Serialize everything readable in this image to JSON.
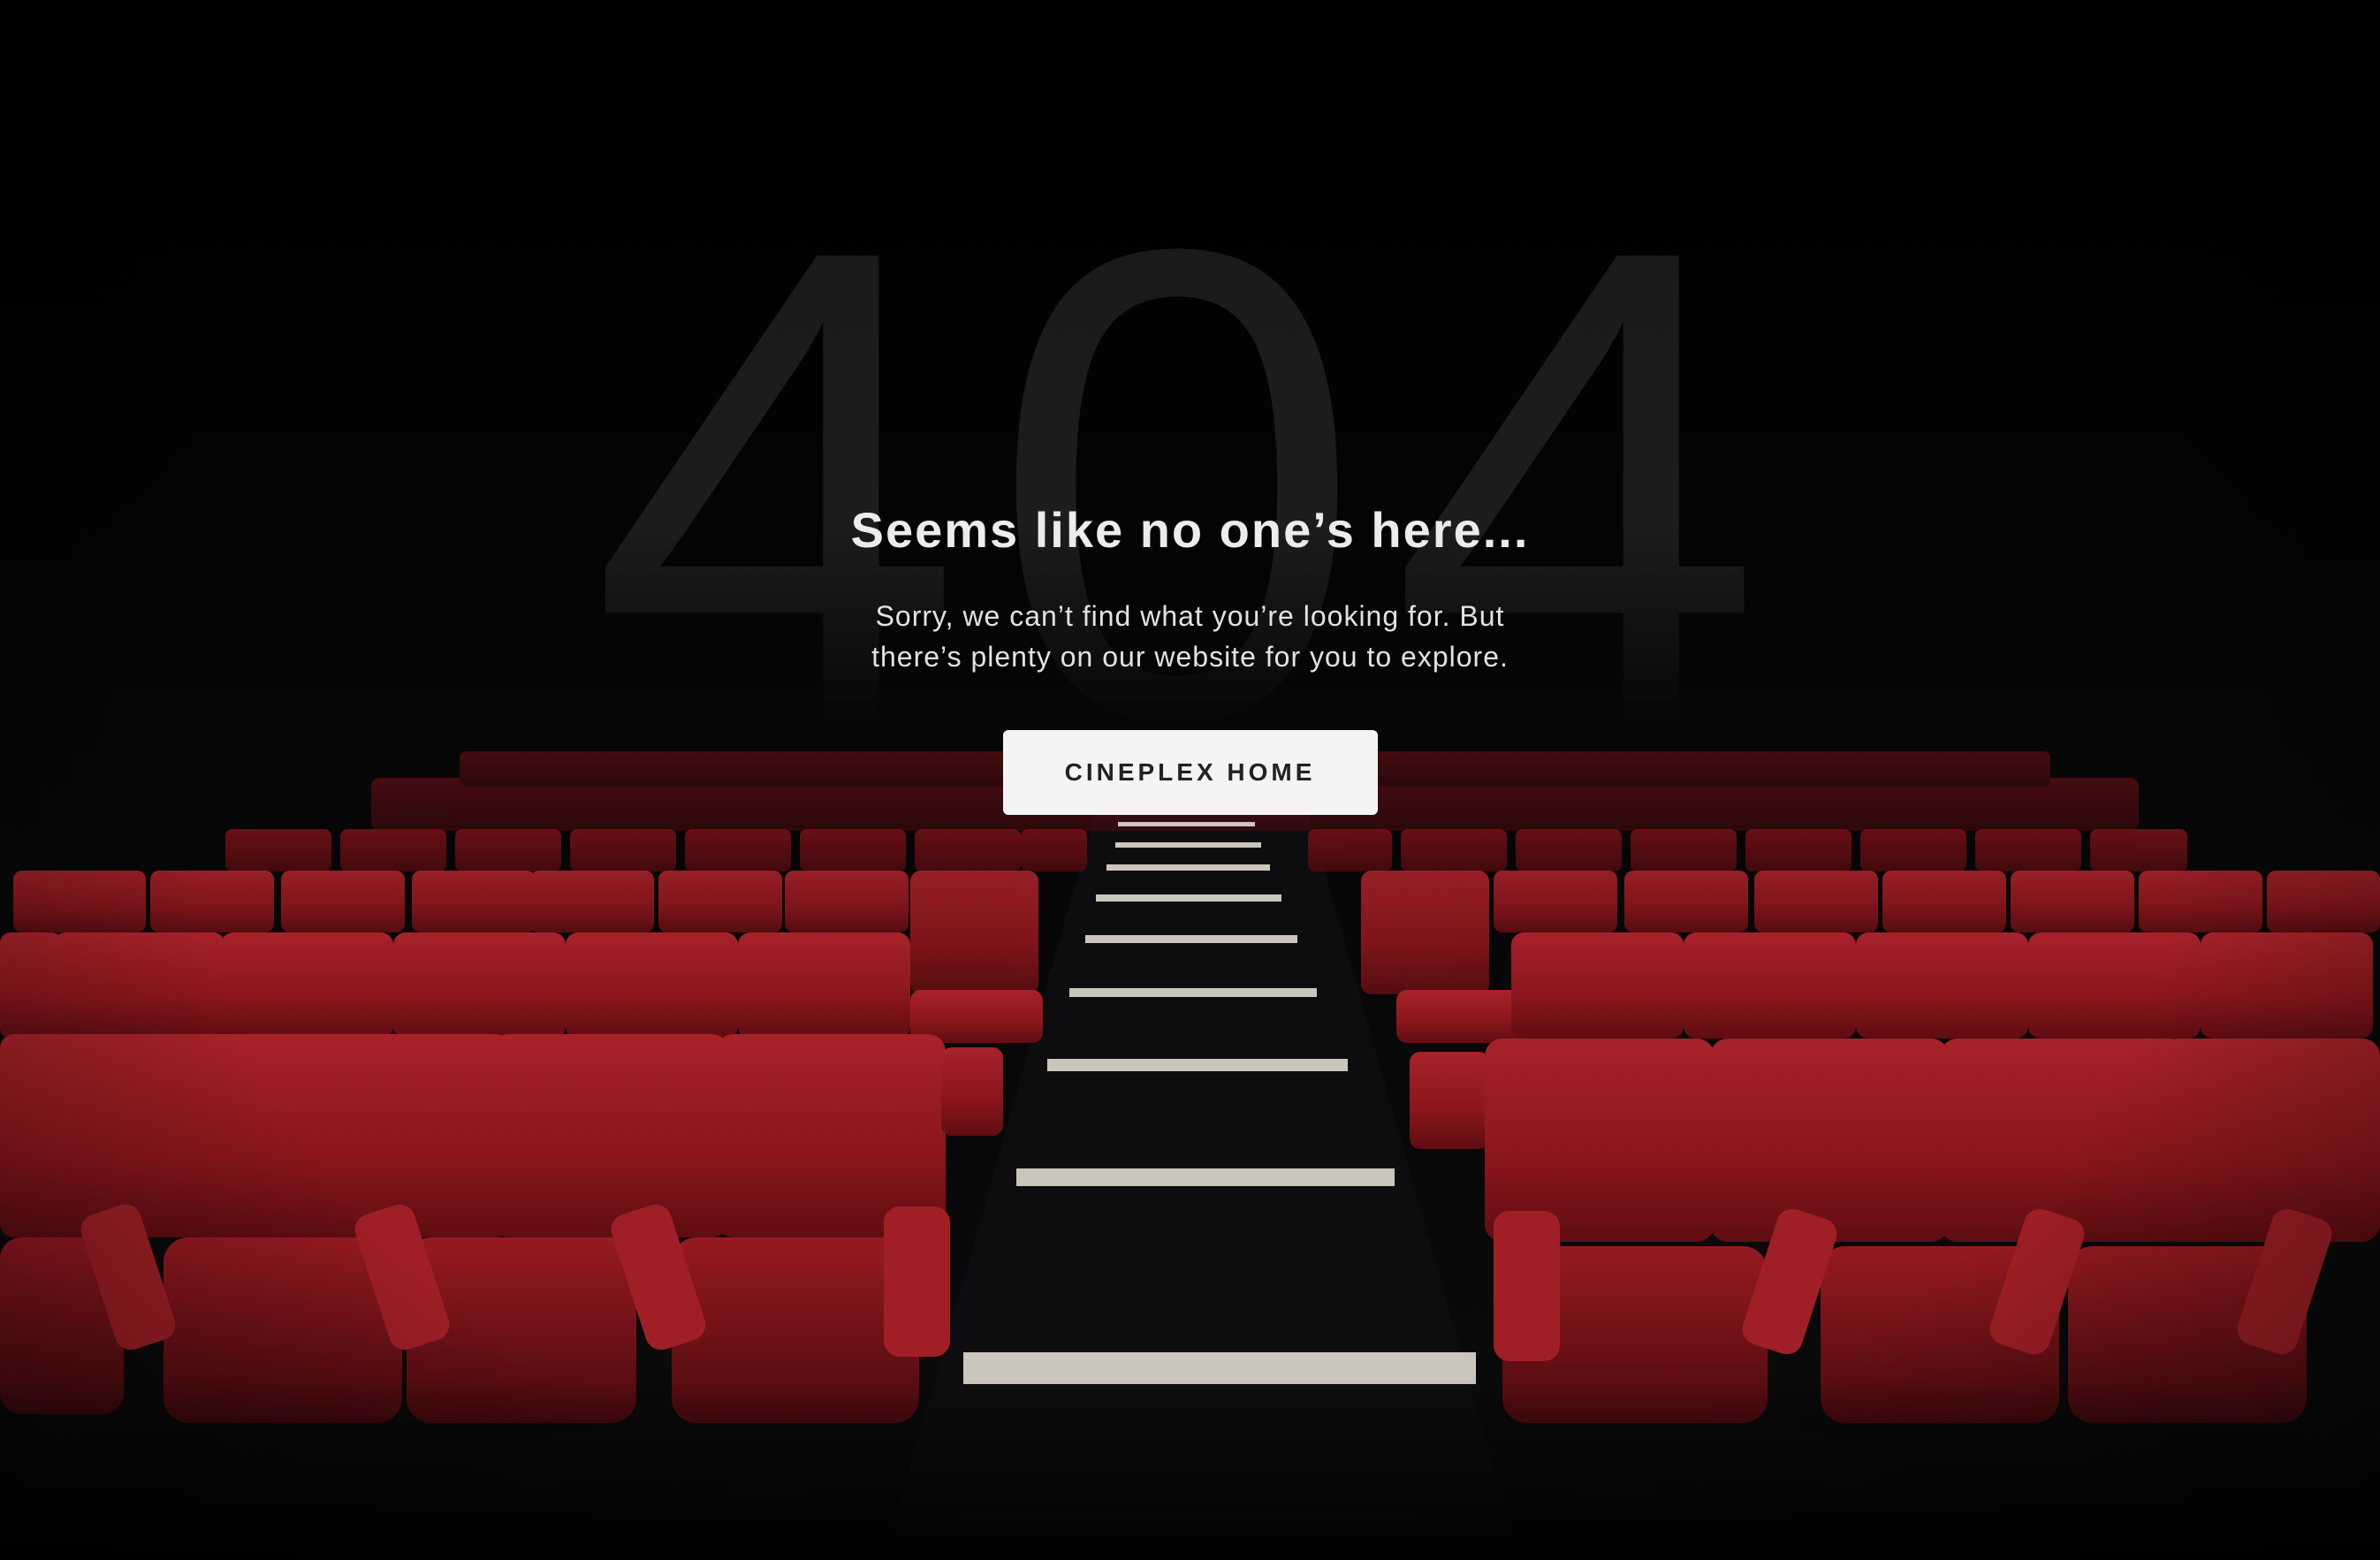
{
  "error": {
    "code": "404",
    "headline": "Seems like no one’s here...",
    "message_line1": "Sorry, we can’t find what you’re looking for. But",
    "message_line2": "there’s plenty on our website for you to explore.",
    "button_label": "CINEPLEX HOME"
  },
  "background": {
    "scene": "empty cinema with red seats and lit aisle steps",
    "seat_color": "#8e1a1e",
    "step_color": "#cfcac0"
  }
}
